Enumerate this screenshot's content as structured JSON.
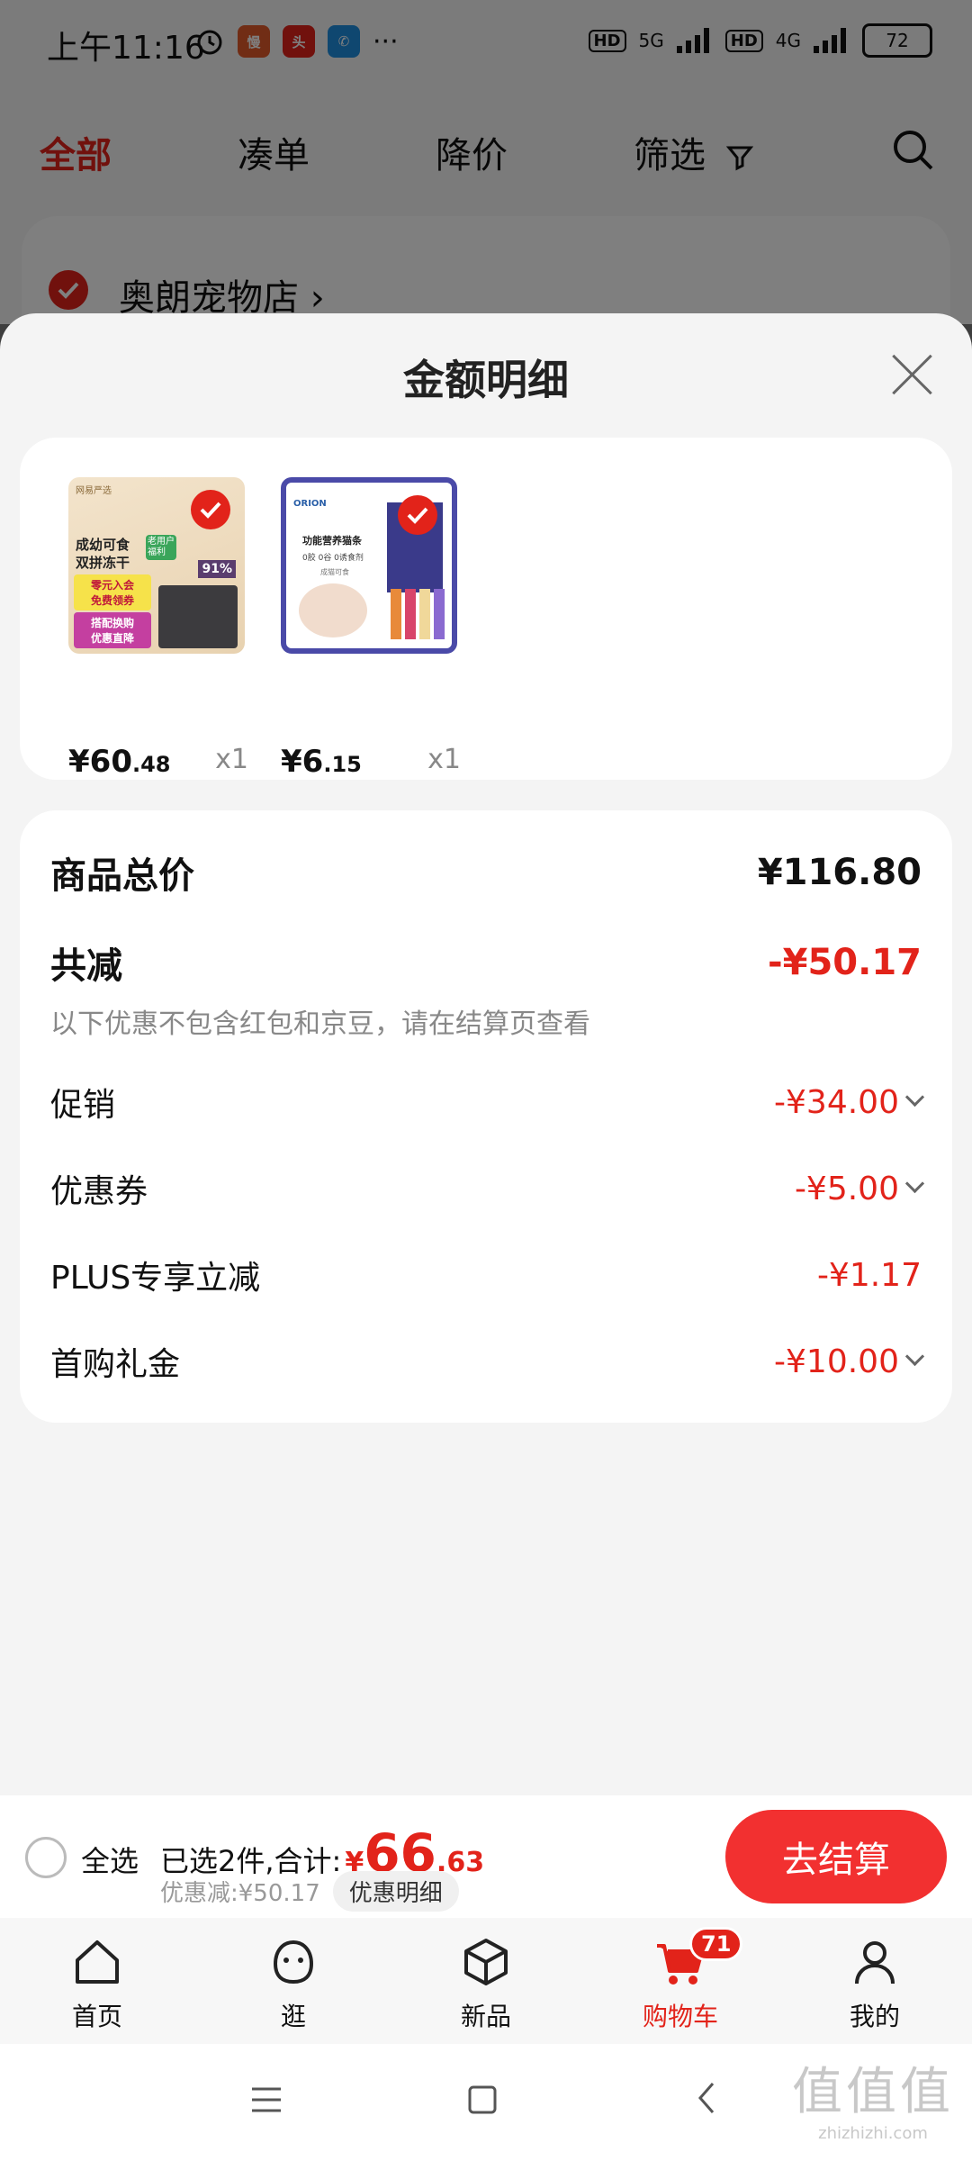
{
  "status_bar": {
    "time": "上午11:16",
    "signal_5g": "5G",
    "signal_4g": "4G",
    "hd": "HD",
    "battery": "72",
    "more": "···"
  },
  "tabs": [
    {
      "label": "全部",
      "active": true
    },
    {
      "label": "凑单"
    },
    {
      "label": "降价"
    },
    {
      "label": "筛选"
    }
  ],
  "store": {
    "name": "奥朗宠物店",
    "arrow": "›"
  },
  "sheet": {
    "title": "金额明细",
    "products": [
      {
        "price_int": "¥60",
        "price_frac": ".48",
        "qty": "x1",
        "brand": "网易严选",
        "line1": "成幼可食",
        "line2": "双拼冻干",
        "tag": "老用户福利",
        "stat": "91%",
        "promo1": "零元入会",
        "promo2": "免费领券",
        "promo3": "搭配换购",
        "promo4": "优惠直降"
      },
      {
        "price_int": "¥6",
        "price_frac": ".15",
        "qty": "x1",
        "brand": "ORION",
        "line1": "功能营养猫条",
        "line2": "0胶 0谷 0诱食剂",
        "line3": "成猫可食"
      }
    ],
    "summary": {
      "total_label": "商品总价",
      "total_value": "¥116.80",
      "reduce_label": "共减",
      "reduce_value": "-¥50.17",
      "note": "以下优惠不包含红包和京豆，请在结算页查看",
      "items": [
        {
          "label": "促销",
          "value": "-¥34.00",
          "expand": true
        },
        {
          "label": "优惠券",
          "value": "-¥5.00",
          "expand": true
        },
        {
          "label": "PLUS专享立减",
          "value": "-¥1.17",
          "expand": false
        },
        {
          "label": "首购礼金",
          "value": "-¥10.00",
          "expand": true
        }
      ]
    }
  },
  "checkout": {
    "select_all": "全选",
    "selected_text": "已选2件,合计:",
    "total_symbol": "¥",
    "total_int": "66",
    "total_frac": ".63",
    "discount_text": "优惠减:¥50.17",
    "detail_button": "优惠明细",
    "checkout_button": "去结算"
  },
  "bottom_nav": [
    {
      "label": "首页"
    },
    {
      "label": "逛"
    },
    {
      "label": "新品"
    },
    {
      "label": "购物车",
      "active": true,
      "badge": "71"
    },
    {
      "label": "我的"
    }
  ],
  "watermark": {
    "big": "值值值",
    "small": "zhizhizhi.com"
  },
  "colors": {
    "accent": "#e2231a",
    "button": "#f23030"
  }
}
